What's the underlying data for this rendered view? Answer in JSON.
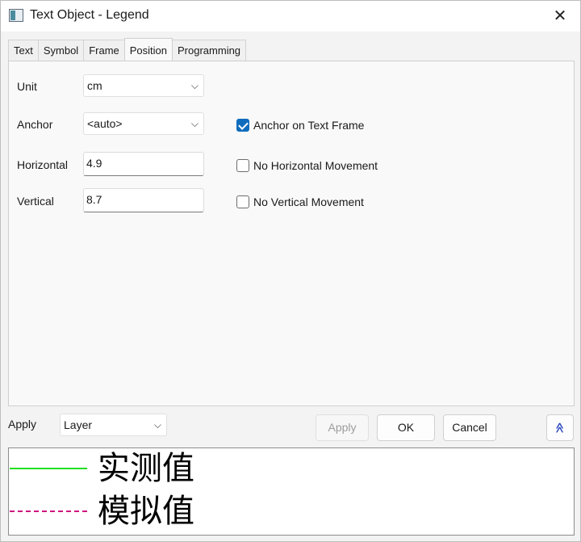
{
  "window": {
    "title": "Text Object - Legend",
    "close_glyph": "✕"
  },
  "tabs": [
    {
      "label": "Text"
    },
    {
      "label": "Symbol"
    },
    {
      "label": "Frame"
    },
    {
      "label": "Position",
      "active": true
    },
    {
      "label": "Programming"
    }
  ],
  "position": {
    "unit_label": "Unit",
    "unit_value": "cm",
    "anchor_label": "Anchor",
    "anchor_value": "<auto>",
    "horizontal_label": "Horizontal",
    "horizontal_value": "4.9",
    "vertical_label": "Vertical",
    "vertical_value": "8.7",
    "anchor_on_frame_label": "Anchor on Text Frame",
    "anchor_on_frame_checked": true,
    "no_horizontal_label": "No Horizontal Movement",
    "no_horizontal_checked": false,
    "no_vertical_label": "No Vertical Movement",
    "no_vertical_checked": false
  },
  "bottom": {
    "apply_label": "Apply",
    "apply_scope": "Layer",
    "apply_button": "Apply",
    "ok_button": "OK",
    "cancel_button": "Cancel",
    "expand_glyph": "≪"
  },
  "preview": {
    "entries": [
      {
        "text": "实测值",
        "line_style": "solid",
        "color": "#22e022"
      },
      {
        "text": "模拟值",
        "line_style": "dashed",
        "color": "#d01080"
      }
    ]
  },
  "colors": {
    "accent": "#0f6cbd",
    "expand_icon": "#1f3fbf"
  },
  "icons": {
    "window": "window-icon",
    "close": "close-icon",
    "dropdown": "chevron-down-icon",
    "expand": "double-chevron-up-icon"
  }
}
